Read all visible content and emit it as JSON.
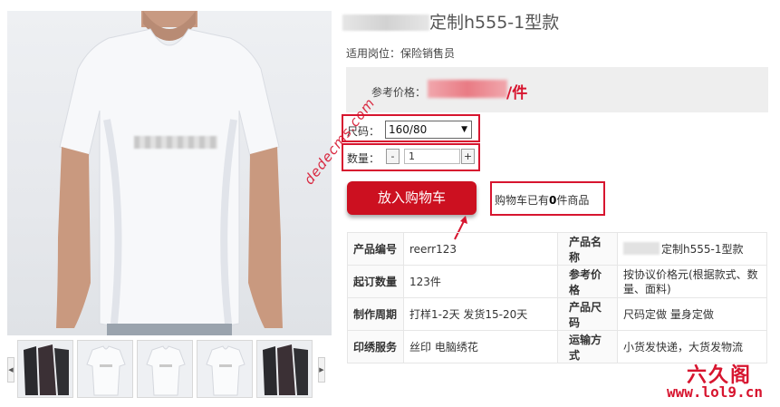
{
  "product": {
    "title_suffix": "定制h555-1型款",
    "applicable_label": "适用岗位：保险销售员",
    "price_label": "参考价格：",
    "price_unit": "/件"
  },
  "options": {
    "size_label": "尺码：",
    "size_value": "160/80",
    "qty_label": "数量：",
    "qty_minus": "-",
    "qty_plus": "+",
    "qty_value": "1"
  },
  "cart": {
    "button_label": "放入购物车",
    "count_prefix": "购物车已有",
    "count_value": "0",
    "count_suffix": "件商品"
  },
  "attributes": [
    {
      "k1": "产品编号",
      "v1": "reerr123",
      "k2": "产品名称",
      "v2": "定制h555-1型款"
    },
    {
      "k1": "起订数量",
      "v1": "123件",
      "k2": "参考价格",
      "v2": "按协议价格元(根据款式、数量、面料)"
    },
    {
      "k1": "制作周期",
      "v1": "打样1-2天 发货15-20天",
      "k2": "产品尺码",
      "v2": "尺码定做 量身定做"
    },
    {
      "k1": "印绣服务",
      "v1": "丝印 电脑绣花",
      "k2": "运输方式",
      "v2": "小货发快递，大货发物流"
    }
  ],
  "watermark": {
    "diag_text": "dedecms.com",
    "site_logo": "六久阁",
    "site_url": "www.lol9.cn"
  },
  "gallery": {
    "thumbs": [
      "coat-dark",
      "tshirt-white",
      "tshirt-white",
      "tshirt-white",
      "coat-dark"
    ],
    "prev_glyph": "◀",
    "next_glyph": "▶"
  },
  "colors": {
    "accent": "#d7152f",
    "cart_button": "#cc1020",
    "price_box": "#eeeeee"
  }
}
